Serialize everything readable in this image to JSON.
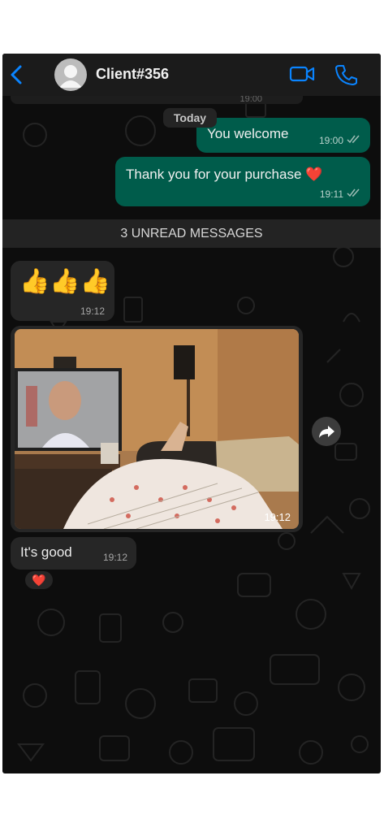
{
  "header": {
    "contact_name": "Client#356",
    "back_icon": "chevron-left-icon",
    "video_icon": "video-camera-icon",
    "call_icon": "phone-icon",
    "accent_color": "#0a84ff"
  },
  "chat": {
    "previous_bubble_time": "19:00",
    "date_separator": "Today",
    "unread_banner": "3 UNREAD MESSAGES",
    "messages": [
      {
        "direction": "out",
        "text": "You welcome",
        "time": "19:00",
        "status": "read"
      },
      {
        "direction": "out",
        "text": "Thank you for your purchase ❤️",
        "time": "19:11",
        "status": "read"
      },
      {
        "direction": "in",
        "text": "👍👍👍",
        "time": "19:12"
      },
      {
        "direction": "in",
        "type": "photo",
        "time": "19:12"
      },
      {
        "direction": "in",
        "text": "It's good",
        "time": "19:12",
        "reaction": "❤️"
      }
    ],
    "outgoing_bubble_color": "#005c4b",
    "incoming_bubble_color": "#262626"
  }
}
